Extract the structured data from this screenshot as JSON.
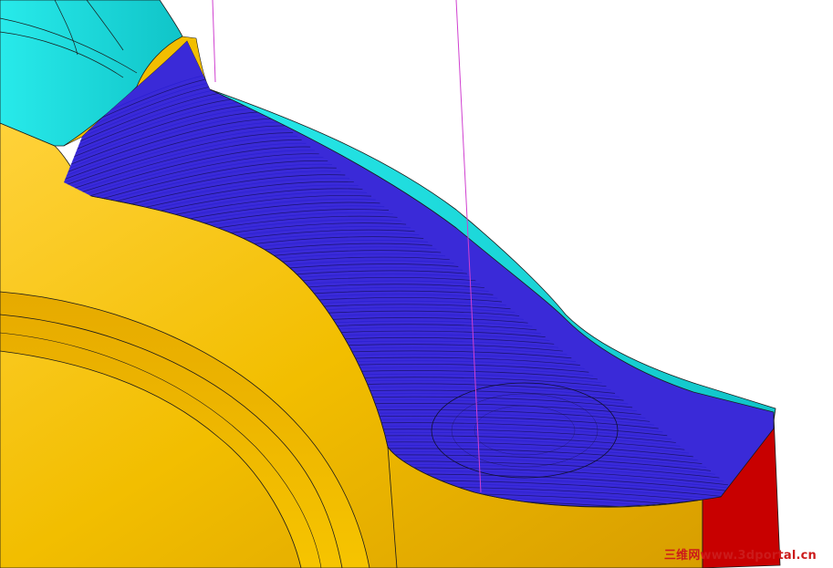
{
  "viewport": {
    "description_free": true
  },
  "colors": {
    "background": "#ffffff",
    "part_gold": "#f2be00",
    "part_gold_dark": "#d89e00",
    "part_gold_light": "#ffd23a",
    "stock_cyan": "#19e0e0",
    "stock_cyan_dark": "#10b8c0",
    "toolpath_blue": "#2a1fd0",
    "toolpath_black": "#101030",
    "wall_red": "#c80000",
    "tool_axis_magenta": "#d040d0",
    "edge_dark": "#1a1a1a"
  },
  "icons": {
    "tool_axis": "tool-axis-line"
  },
  "watermark": {
    "text": "三维网www.3dportal.cn"
  }
}
